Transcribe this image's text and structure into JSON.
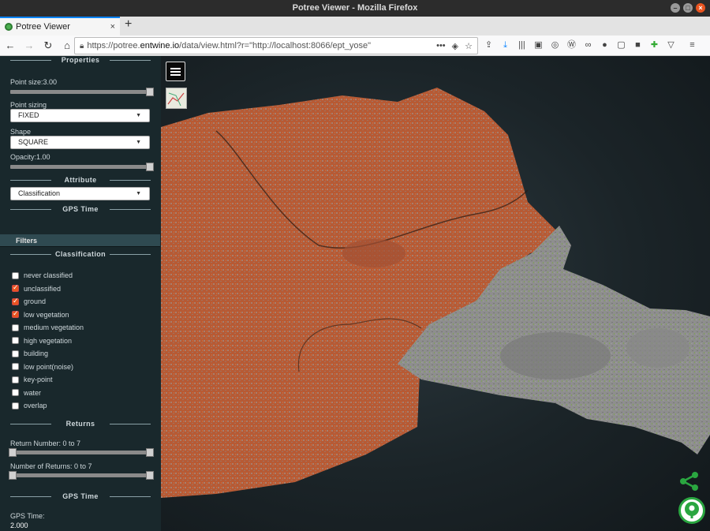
{
  "window": {
    "title": "Potree Viewer - Mozilla Firefox"
  },
  "tab": {
    "title": "Potree Viewer",
    "close": "×",
    "new_tab": "+"
  },
  "nav": {
    "back": "←",
    "forward": "→",
    "reload": "↻",
    "home": "⌂",
    "url_prefix": "https://potree.",
    "url_host": "entwine.io",
    "url_path": "/data/view.html?r=\"http://localhost:8066/ept_yose\"",
    "url_more": "•••"
  },
  "sidebar": {
    "properties_title": "Properties",
    "point_size_label": "Point size:3.00",
    "point_size_value": 1.0,
    "point_sizing_label": "Point sizing",
    "point_sizing_value": "FIXED",
    "shape_label": "Shape",
    "shape_value": "SQUARE",
    "opacity_label": "Opacity:1.00",
    "opacity_value": 1.0,
    "attribute_title": "Attribute",
    "attribute_value": "Classification",
    "gps_time_title": "GPS Time",
    "filters_label": "Filters",
    "classification_title": "Classification",
    "classes": [
      {
        "label": "never classified",
        "checked": false
      },
      {
        "label": "unclassified",
        "checked": true
      },
      {
        "label": "ground",
        "checked": true
      },
      {
        "label": "low vegetation",
        "checked": true
      },
      {
        "label": "medium vegetation",
        "checked": false
      },
      {
        "label": "high vegetation",
        "checked": false
      },
      {
        "label": "building",
        "checked": false
      },
      {
        "label": "low point(noise)",
        "checked": false
      },
      {
        "label": "key-point",
        "checked": false
      },
      {
        "label": "water",
        "checked": false
      },
      {
        "label": "overlap",
        "checked": false
      }
    ],
    "returns_title": "Returns",
    "return_number_label": "Return Number: 0 to 7",
    "num_returns_label": "Number of Returns: 0 to 7",
    "gps_time_title_2": "GPS Time",
    "gps_time_label": "GPS Time:",
    "gps_time_value": "2.000"
  },
  "colors": {
    "accent": "#e95420",
    "sidebar_bg": "#19282c",
    "terrain_orange": "#c5643a",
    "terrain_grey": "#8d8d8d",
    "vegetation_green": "#7aa84a",
    "logo_green": "#2aa640"
  }
}
